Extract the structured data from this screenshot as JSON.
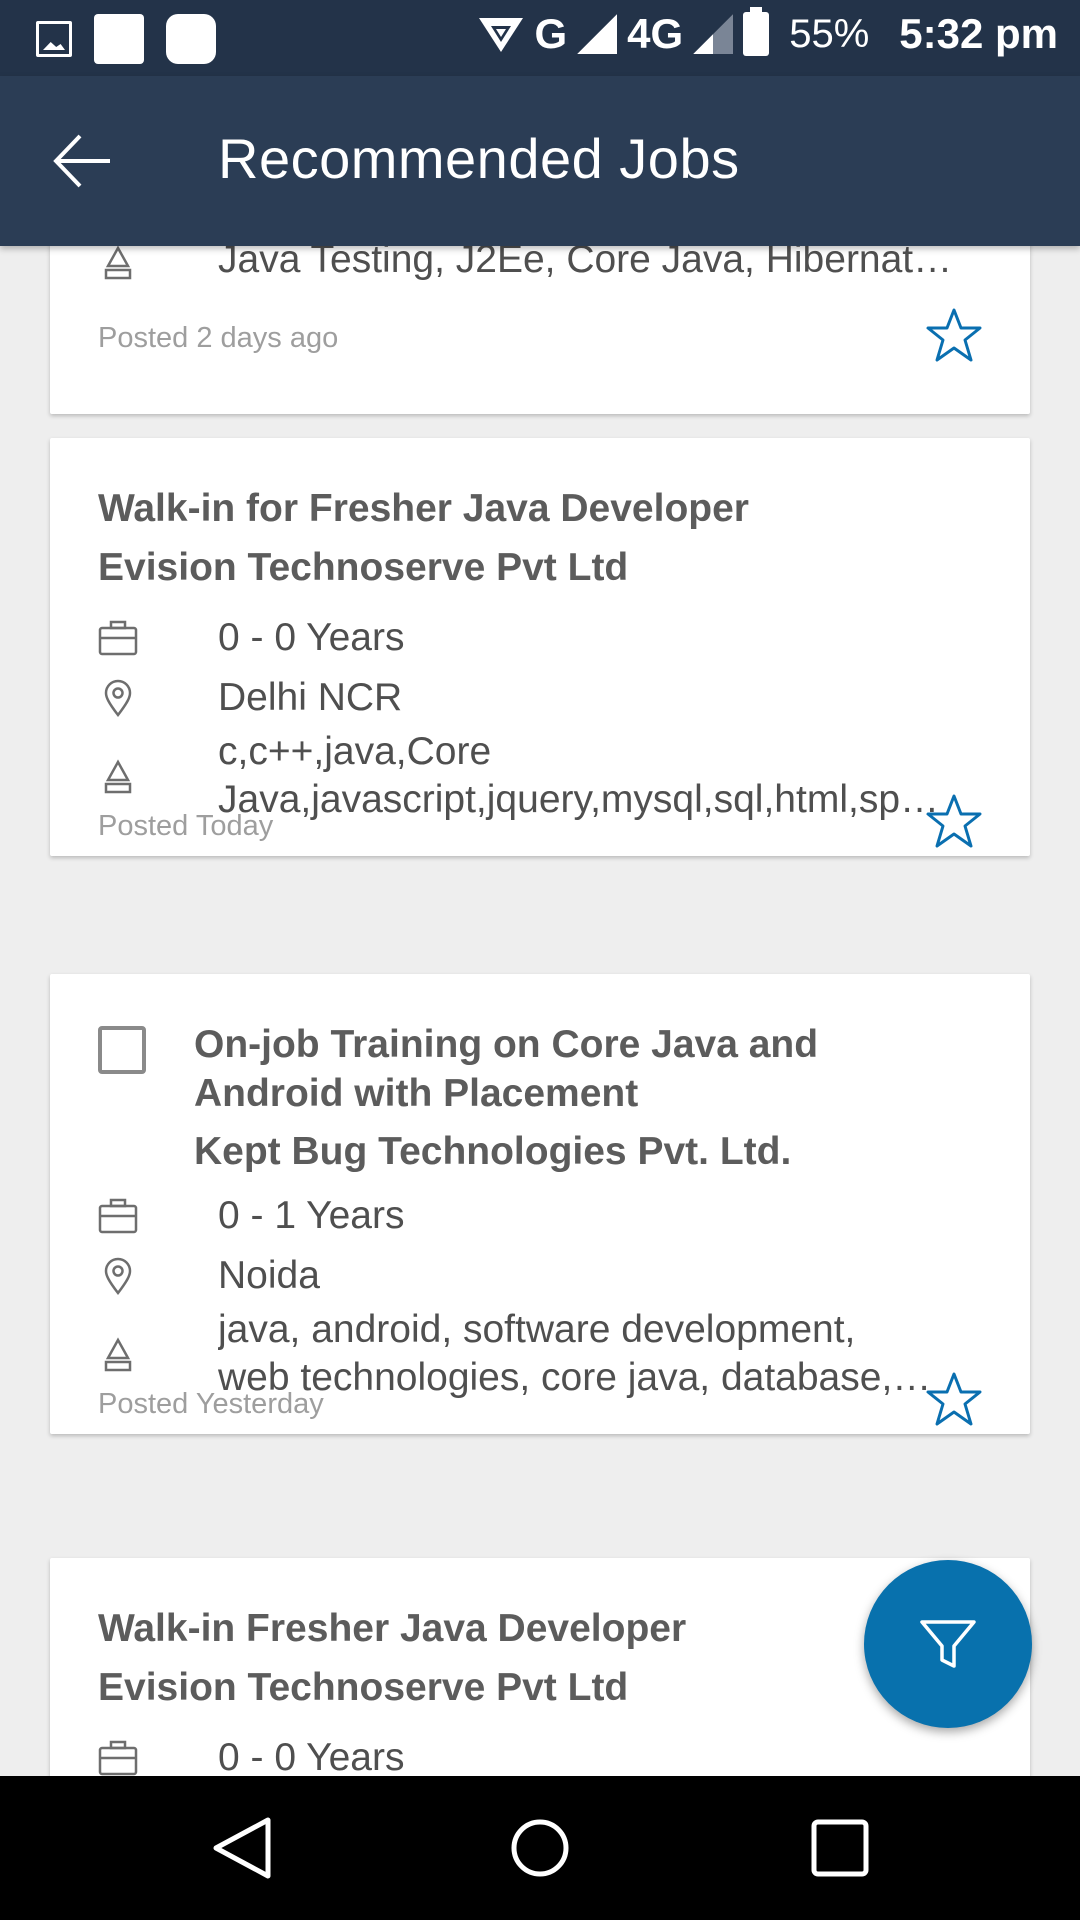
{
  "status_bar": {
    "network_g": "G",
    "network_4g": "4G",
    "battery": "55%",
    "time": "5:32 pm"
  },
  "app_bar": {
    "title": "Recommended Jobs"
  },
  "colors": {
    "app_bar": "#2b3d55",
    "status_bar": "#233349",
    "accent": "#0871ad",
    "star": "#0a6fb0"
  },
  "jobs": [
    {
      "skills": "Java Testing, J2Ee, Core Java, Hibernat…",
      "posted": "Posted 2 days ago",
      "saved": false
    },
    {
      "title": "Walk-in for Fresher Java Developer",
      "company": "Evision Technoserve Pvt Ltd",
      "experience": "0 - 0 Years",
      "location": "Delhi NCR",
      "skills_line1": "c,c++,java,Core",
      "skills_line2": "Java,javascript,jquery,mysql,sql,html,sp…",
      "posted": "Posted Today",
      "saved": false
    },
    {
      "title_line1": "On-job Training on Core Java and",
      "title_line2": "Android with Placement",
      "company": "Kept Bug Technologies Pvt. Ltd.",
      "experience": "0 - 1 Years",
      "location": "Noida",
      "skills_line1": "java, android, software development,",
      "skills_line2": "web technologies, core java, database,…",
      "posted": "Posted Yesterday",
      "saved": false,
      "checked": false
    },
    {
      "title": "Walk-in Fresher Java Developer",
      "company": "Evision Technoserve Pvt Ltd",
      "experience": "0 - 0 Years"
    }
  ],
  "icons": {
    "back": "arrow-left-icon",
    "experience": "briefcase-icon",
    "location": "map-pin-icon",
    "skills": "skills-icon",
    "save": "star-icon",
    "filter": "filter-icon"
  }
}
